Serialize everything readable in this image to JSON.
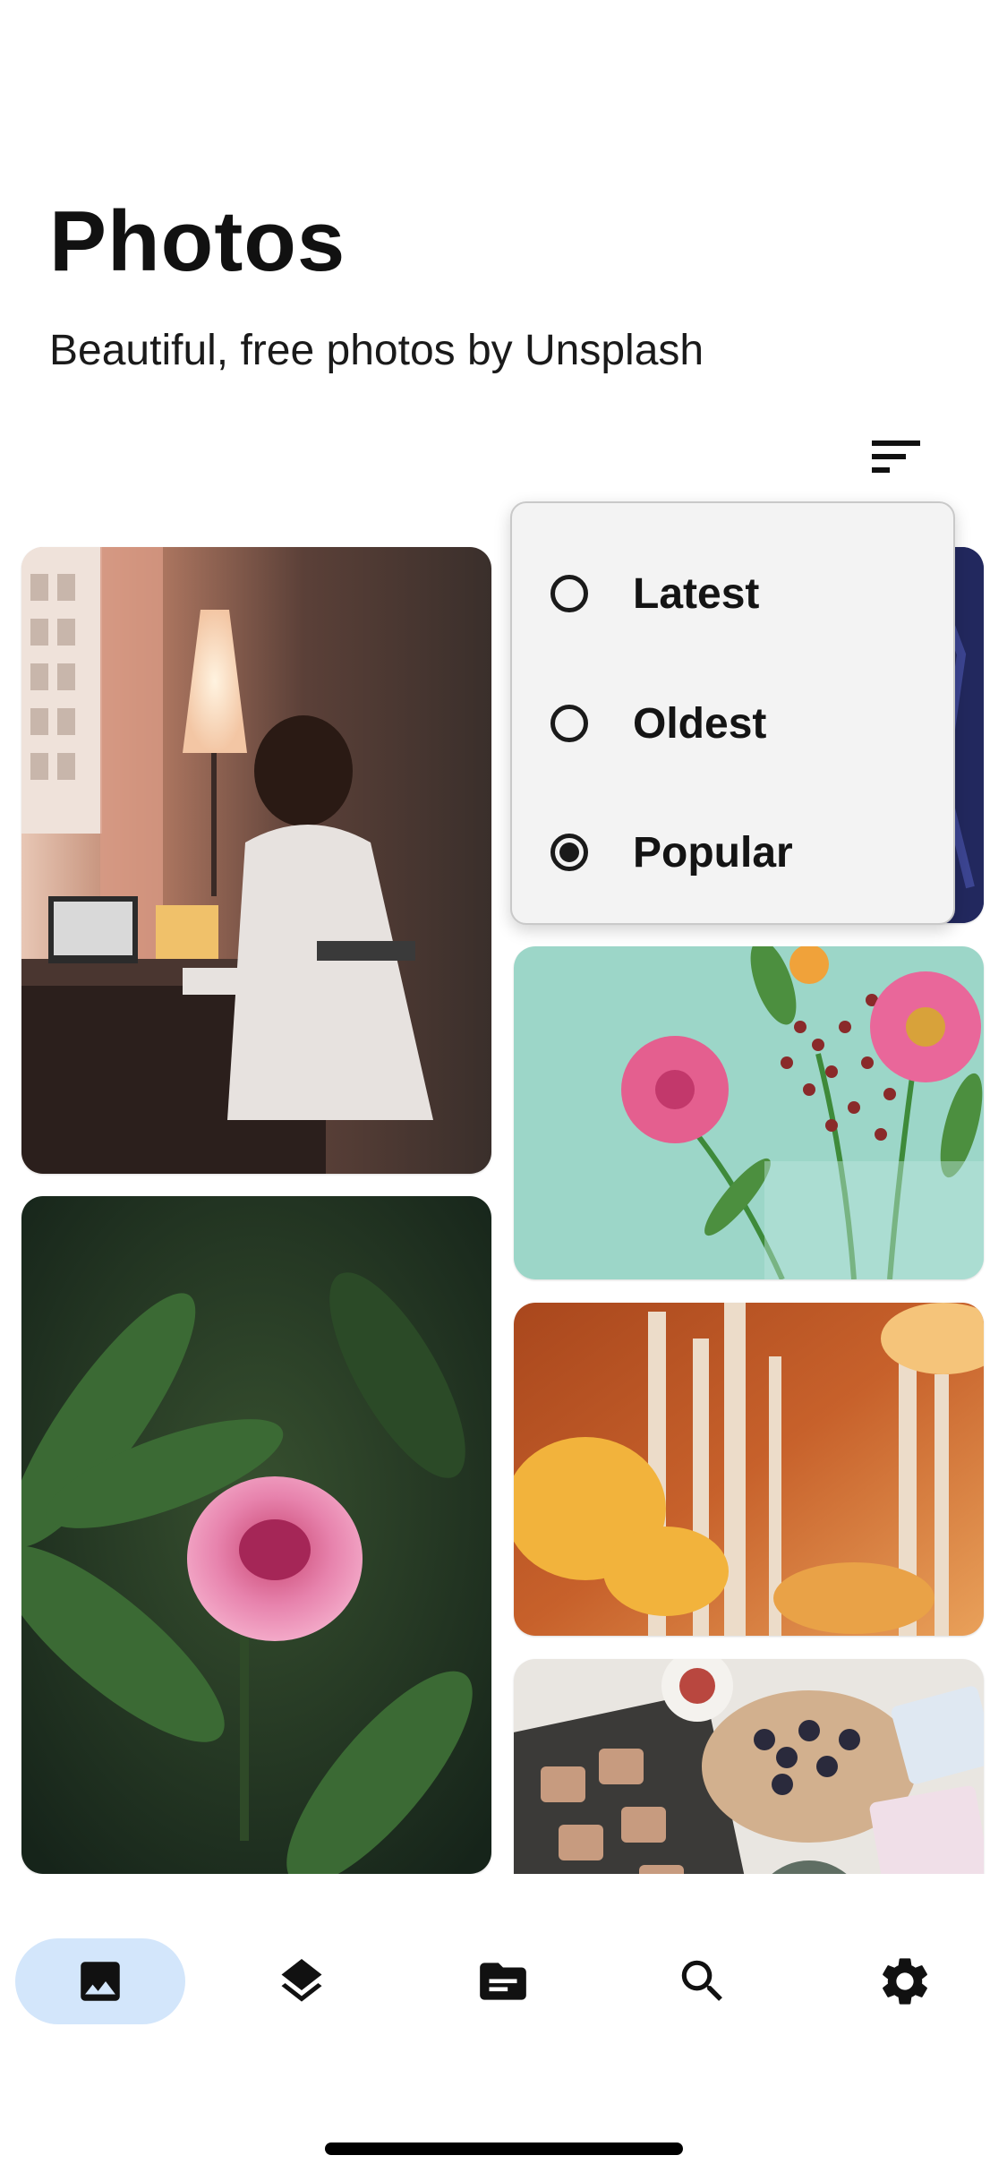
{
  "header": {
    "title": "Photos",
    "subtitle": "Beautiful, free photos by Unsplash"
  },
  "sort_menu": {
    "icon": "sort-icon",
    "options": [
      {
        "label": "Latest",
        "selected": false
      },
      {
        "label": "Oldest",
        "selected": false
      },
      {
        "label": "Popular",
        "selected": true
      }
    ]
  },
  "photos": [
    {
      "name": "photo-man-at-desk"
    },
    {
      "name": "photo-dark-blue"
    },
    {
      "name": "photo-pink-flowers"
    },
    {
      "name": "photo-peony"
    },
    {
      "name": "photo-autumn-birch"
    },
    {
      "name": "photo-food-table"
    }
  ],
  "bottom_nav": {
    "items": [
      {
        "icon": "image-icon",
        "active": true
      },
      {
        "icon": "layers-icon",
        "active": false
      },
      {
        "icon": "folder-icon",
        "active": false
      },
      {
        "icon": "search-icon",
        "active": false
      },
      {
        "icon": "settings-icon",
        "active": false
      }
    ]
  },
  "colors": {
    "active_nav_bg": "#d3e6fb",
    "menu_bg": "#f3f3f3",
    "text": "#111111"
  }
}
